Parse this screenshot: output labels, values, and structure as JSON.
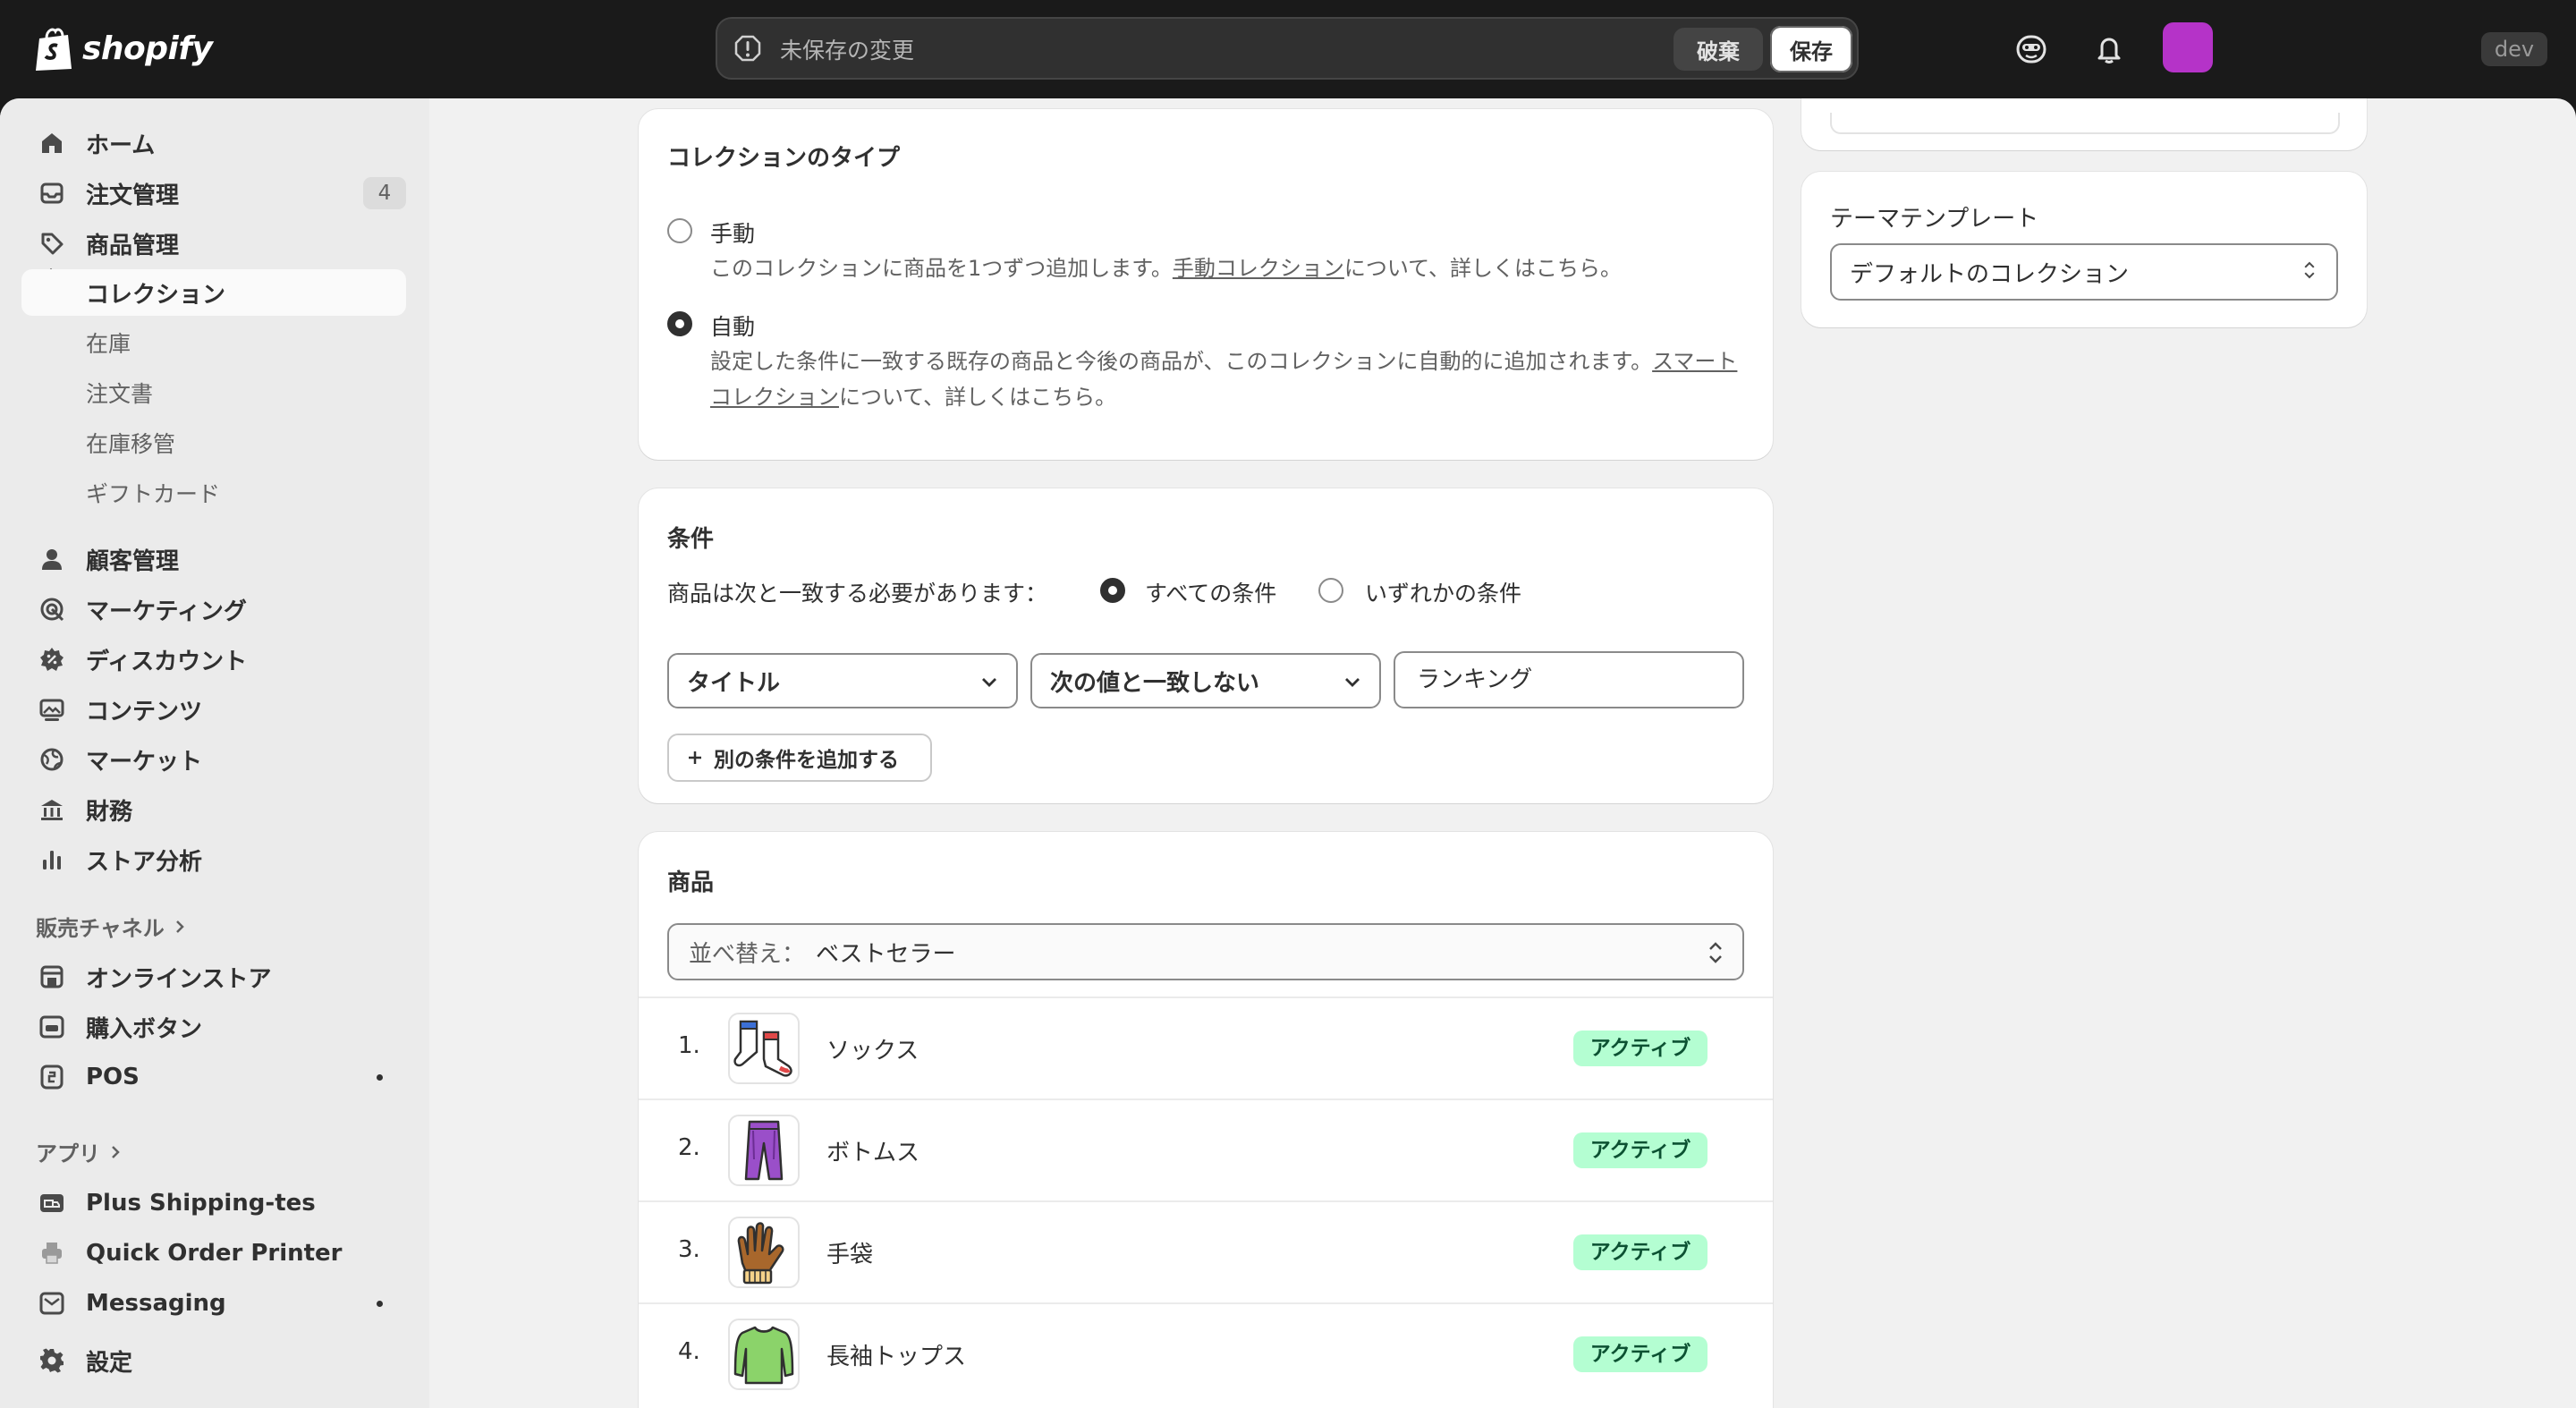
{
  "brand": {
    "name": "shopify"
  },
  "savebar": {
    "message": "未保存の変更",
    "discard_label": "破棄",
    "save_label": "保存"
  },
  "topbar": {
    "dev_label": "dev",
    "avatar_color": "#b533c8"
  },
  "sidebar": {
    "items": [
      {
        "label": "ホーム",
        "icon": "home-icon"
      },
      {
        "label": "注文管理",
        "icon": "inbox-icon",
        "count": "4"
      },
      {
        "label": "商品管理",
        "icon": "tag-icon"
      }
    ],
    "products_sub": [
      "コレクション",
      "在庫",
      "注文書",
      "在庫移管",
      "ギフトカード"
    ],
    "items2": [
      {
        "label": "顧客管理",
        "icon": "person-icon"
      },
      {
        "label": "マーケティング",
        "icon": "target-icon"
      },
      {
        "label": "ディスカウント",
        "icon": "discount-icon"
      },
      {
        "label": "コンテンツ",
        "icon": "content-icon"
      },
      {
        "label": "マーケット",
        "icon": "globe-icon"
      },
      {
        "label": "財務",
        "icon": "bank-icon"
      },
      {
        "label": "ストア分析",
        "icon": "chart-icon"
      }
    ],
    "sales_channels_heading": "販売チャネル",
    "channels": [
      {
        "label": "オンラインストア",
        "icon": "store-icon"
      },
      {
        "label": "購入ボタン",
        "icon": "buy-button-icon"
      },
      {
        "label": "POS",
        "icon": "pos-icon"
      }
    ],
    "apps_heading": "アプリ",
    "apps": [
      {
        "label": "Plus Shipping-tes",
        "icon": "shipping-app-icon"
      },
      {
        "label": "Quick Order Printer",
        "icon": "printer-icon"
      },
      {
        "label": "Messaging",
        "icon": "message-icon"
      }
    ],
    "settings_label": "設定"
  },
  "collection_type": {
    "title": "コレクションのタイプ",
    "manual": {
      "label": "手動",
      "desc_prefix": "このコレクションに商品を1つずつ追加します。",
      "desc_link": "手動コレクション",
      "desc_suffix": "について、詳しくはこちら。"
    },
    "auto": {
      "label": "自動",
      "desc_prefix": "設定した条件に一致する既存の商品と今後の商品が、このコレクションに自動的に追加されます。",
      "desc_link_1": "スマート",
      "desc_link_2": "コレクション",
      "desc_suffix": "について、詳しくはこちら。"
    },
    "selected": "auto"
  },
  "conditions": {
    "title": "条件",
    "match_prompt": "商品は次と一致する必要があります：",
    "all_label": "すべての条件",
    "any_label": "いずれかの条件",
    "field": "タイトル",
    "operator": "次の値と一致しない",
    "value": "ランキング",
    "add_label": "別の条件を追加する"
  },
  "products": {
    "title": "商品",
    "sort_prefix": "並べ替え：",
    "sort_value": "ベストセラー",
    "rows": [
      {
        "num": "1.",
        "name": "ソックス",
        "status": "アクティブ",
        "thumb": "socks-image"
      },
      {
        "num": "2.",
        "name": "ボトムス",
        "status": "アクティブ",
        "thumb": "pants-image"
      },
      {
        "num": "3.",
        "name": "手袋",
        "status": "アクティブ",
        "thumb": "gloves-image"
      },
      {
        "num": "4.",
        "name": "長袖トップス",
        "status": "アクティブ",
        "thumb": "longsleeve-image"
      }
    ]
  },
  "theme_template": {
    "title": "テーマテンプレート",
    "value": "デフォルトのコレクション"
  }
}
